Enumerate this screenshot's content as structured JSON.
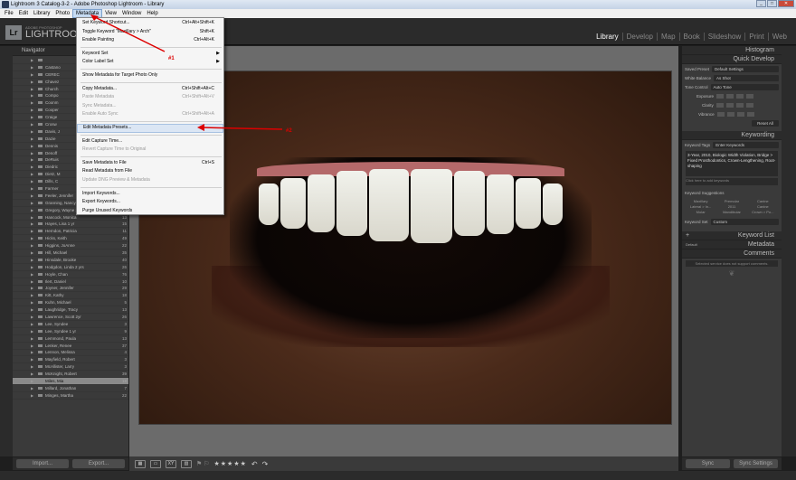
{
  "window": {
    "title": "Lightroom 3 Catalog-3-2 - Adobe Photoshop Lightroom - Library"
  },
  "menubar": [
    "File",
    "Edit",
    "Library",
    "Photo",
    "Metadata",
    "View",
    "Window",
    "Help"
  ],
  "active_menu": "Metadata",
  "brand": {
    "small": "ADOBE PHOTOSHOP",
    "big": "LIGHTROO"
  },
  "logo": "Lr",
  "modules": [
    "Library",
    "Develop",
    "Map",
    "Book",
    "Slideshow",
    "Print",
    "Web"
  ],
  "active_module": "Library",
  "metadata_menu": [
    {
      "label": "Set Keyword Shortcut...",
      "shortcut": "Ctrl+Alt+Shift+K"
    },
    {
      "label": "Toggle Keyword \"Maxillary > Arch\"",
      "shortcut": "Shift+K"
    },
    {
      "label": "Enable Painting",
      "shortcut": "Ctrl+Alt+K"
    },
    {
      "sep": true
    },
    {
      "label": "Keyword Set",
      "submenu": true
    },
    {
      "label": "Color Label Set",
      "submenu": true
    },
    {
      "sep": true
    },
    {
      "label": "Show Metadata for Target Photo Only"
    },
    {
      "sep": true
    },
    {
      "label": "Copy Metadata...",
      "shortcut": "Ctrl+Shift+Alt+C"
    },
    {
      "label": "Paste Metadata",
      "shortcut": "Ctrl+Shift+Alt+V",
      "disabled": true
    },
    {
      "label": "Sync Metadata...",
      "disabled": true
    },
    {
      "label": "Enable Auto Sync",
      "shortcut": "Ctrl+Shift+Alt+A",
      "disabled": true
    },
    {
      "sep": true
    },
    {
      "label": "Edit Metadata Presets...",
      "highlight": true
    },
    {
      "sep": true
    },
    {
      "label": "Edit Capture Time..."
    },
    {
      "label": "Revert Capture Time to Original",
      "disabled": true
    },
    {
      "sep": true
    },
    {
      "label": "Save Metadata to File",
      "shortcut": "Ctrl+S"
    },
    {
      "label": "Read Metadata from File"
    },
    {
      "label": "Update DNG Preview & Metadata",
      "disabled": true
    },
    {
      "sep": true
    },
    {
      "label": "Import Keywords..."
    },
    {
      "label": "Export Keywords..."
    },
    {
      "label": "Purge Unused Keywords"
    }
  ],
  "annotations": {
    "arrow1": "#1",
    "arrow2": "#2"
  },
  "left_panel": {
    "navigator": "Navigator",
    "folders": [
      {
        "name": "",
        "count": ""
      },
      {
        "name": "Castano",
        "count": ""
      },
      {
        "name": "CEREC",
        "count": ""
      },
      {
        "name": "Chavez",
        "count": ""
      },
      {
        "name": "Church",
        "count": ""
      },
      {
        "name": "Compo",
        "count": ""
      },
      {
        "name": "Coonm",
        "count": ""
      },
      {
        "name": "Cooper",
        "count": ""
      },
      {
        "name": "Craige",
        "count": ""
      },
      {
        "name": "Crosw",
        "count": ""
      },
      {
        "name": "Davis, J",
        "count": ""
      },
      {
        "name": "Dazie",
        "count": ""
      },
      {
        "name": "Dennis",
        "count": ""
      },
      {
        "name": "Denoff",
        "count": ""
      },
      {
        "name": "DeRuis",
        "count": ""
      },
      {
        "name": "Diedric",
        "count": ""
      },
      {
        "name": "Dietz, M",
        "count": ""
      },
      {
        "name": "Dills, C",
        "count": ""
      },
      {
        "name": "Farmer",
        "count": ""
      },
      {
        "name": "Feeler, Jennifer",
        "count": "5"
      },
      {
        "name": "Granning, Nancy",
        "count": "2"
      },
      {
        "name": "Gregory, Wayne 3 yr",
        "count": "37"
      },
      {
        "name": "Hancock, Monica",
        "count": "13"
      },
      {
        "name": "Hayes, Lisa 1 yr",
        "count": "15"
      },
      {
        "name": "Herndon, Patricia",
        "count": "11"
      },
      {
        "name": "Hicks, Keith",
        "count": "49"
      },
      {
        "name": "Higgins, JoAnne",
        "count": "22"
      },
      {
        "name": "Hill, Michael",
        "count": "35"
      },
      {
        "name": "Hinsdale, Brooke",
        "count": "40"
      },
      {
        "name": "Hodgdon, Linda 2 yrs",
        "count": "26"
      },
      {
        "name": "Hoyle, Chan",
        "count": "76"
      },
      {
        "name": "Ilert, Daniel",
        "count": "10"
      },
      {
        "name": "Joyner, Jennifer",
        "count": "29"
      },
      {
        "name": "Kitt, Kathy",
        "count": "18"
      },
      {
        "name": "Kuhn, Michael",
        "count": "5"
      },
      {
        "name": "Laughridge, Tracy",
        "count": "13"
      },
      {
        "name": "Lawrence, Scott 2yr",
        "count": "26"
      },
      {
        "name": "Lee, Syndee",
        "count": "3"
      },
      {
        "name": "Lee, Syndee 1 yr",
        "count": "9"
      },
      {
        "name": "Lemmond, Paula",
        "count": "13"
      },
      {
        "name": "Lenker, Renee",
        "count": "37"
      },
      {
        "name": "Lennon, Melissa",
        "count": "4"
      },
      {
        "name": "Mayfield, Robert",
        "count": "3"
      },
      {
        "name": "McAllister, Larry",
        "count": "3"
      },
      {
        "name": "McKnight, Robert",
        "count": "39"
      },
      {
        "name": "Miles, Mia",
        "count": "18",
        "selected": true
      },
      {
        "name": "Millard, Jonathan",
        "count": "7"
      },
      {
        "name": "Minges, Martha",
        "count": "22"
      }
    ],
    "import_label": "Import...",
    "export_label": "Export..."
  },
  "right_panel": {
    "histogram": "Histogram",
    "quick_develop": "Quick Develop",
    "saved_preset_label": "Saved Preset",
    "saved_preset_value": "Default Settings",
    "white_balance_label": "White Balance",
    "white_balance_value": "As Shot",
    "tone_control_label": "Tone Control",
    "tone_control_value": "Auto Tone",
    "exposure": "Exposure",
    "clarity": "Clarity",
    "vibrance": "Vibrance",
    "reset_all": "Reset All",
    "keywording": "Keywording",
    "keyword_tags_label": "Keyword Tags",
    "keyword_tags_value": "Enter Keywords",
    "keywords_text": "3-Year, 2010, Biologic Width Violation, Bridge > Fixed Prosthodontics, Crown-Lengthening, Root-shaping",
    "keyword_hint": "Click here to add keywords",
    "keyword_suggestions": "Keyword Suggestions",
    "suggestions": [
      "Maxillary",
      "Premolar",
      "Canine",
      "Lateral > In...",
      "2011",
      "Canine",
      "Molar",
      "Mandibular",
      "Crown > Po..."
    ],
    "keyword_set_label": "Keyword Set",
    "keyword_set_value": "Custom",
    "keyword_list": "Keyword List",
    "metadata": "Metadata",
    "metadata_preset": "Default",
    "comments": "Comments",
    "comments_note": "Selected service does not support comments.",
    "sync_label": "Sync",
    "sync_settings_label": "Sync Settings"
  },
  "colors": {
    "panel": "#3a3a3a",
    "dark": "#2b2b2b",
    "annotation": "#dd0000",
    "selected_row": "#8a8a8a"
  }
}
